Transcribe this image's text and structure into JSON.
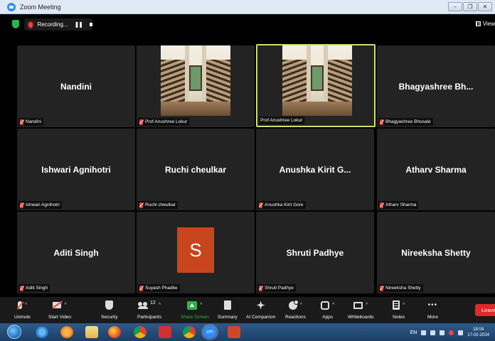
{
  "window": {
    "title": "Zoom Meeting",
    "controls": [
      "–",
      "❐",
      "✕"
    ]
  },
  "status": {
    "recording_label": "Recording...",
    "view_label": "View"
  },
  "tiles": [
    {
      "display": "Nandini",
      "tag": "Nandini"
    },
    {
      "display": "",
      "tag": "Prof Anushree Lokur"
    },
    {
      "display": "",
      "tag": "Prof Anushree Lokur"
    },
    {
      "display": "Bhagyashree Bh...",
      "tag": "Bhagyashree Bhosale"
    },
    {
      "display": "Ishwari Agnihotri",
      "tag": "Ishwari Agnihotri"
    },
    {
      "display": "Ruchi cheulkar",
      "tag": "Ruchi cheulkar"
    },
    {
      "display": "Anushka Kirit G...",
      "tag": "Anushka Kirit Gore"
    },
    {
      "display": "Atharv Sharma",
      "tag": "Atharv Sharma"
    },
    {
      "display": "Aditi Singh",
      "tag": "Aditi Singh"
    },
    {
      "display": "S",
      "tag": "Suyash Phadke"
    },
    {
      "display": "Shruti Padhye",
      "tag": "Shruti Padhye"
    },
    {
      "display": "Nireeksha Shetty",
      "tag": "Nireeksha Shetty"
    }
  ],
  "toolbar": {
    "unmute": "Unmute",
    "start_video": "Start Video",
    "security": "Security",
    "participants": "Participants",
    "participant_count": "12",
    "share_screen": "Share Screen",
    "summary": "Summary",
    "ai_companion": "AI Companion",
    "reactions": "Reactions",
    "apps": "Apps",
    "whiteboards": "Whiteboards",
    "notes": "Notes",
    "more": "More",
    "leave": "Leave"
  },
  "taskbar": {
    "zoom_icon_text": "zm",
    "language": "EN",
    "time": "18:04",
    "date": "17-02-2024"
  },
  "colors": {
    "active_speaker_border": "#c9e16a",
    "leave": "#e02828",
    "share_green": "#2fb34a",
    "avatar_bg": "#c8451d"
  }
}
